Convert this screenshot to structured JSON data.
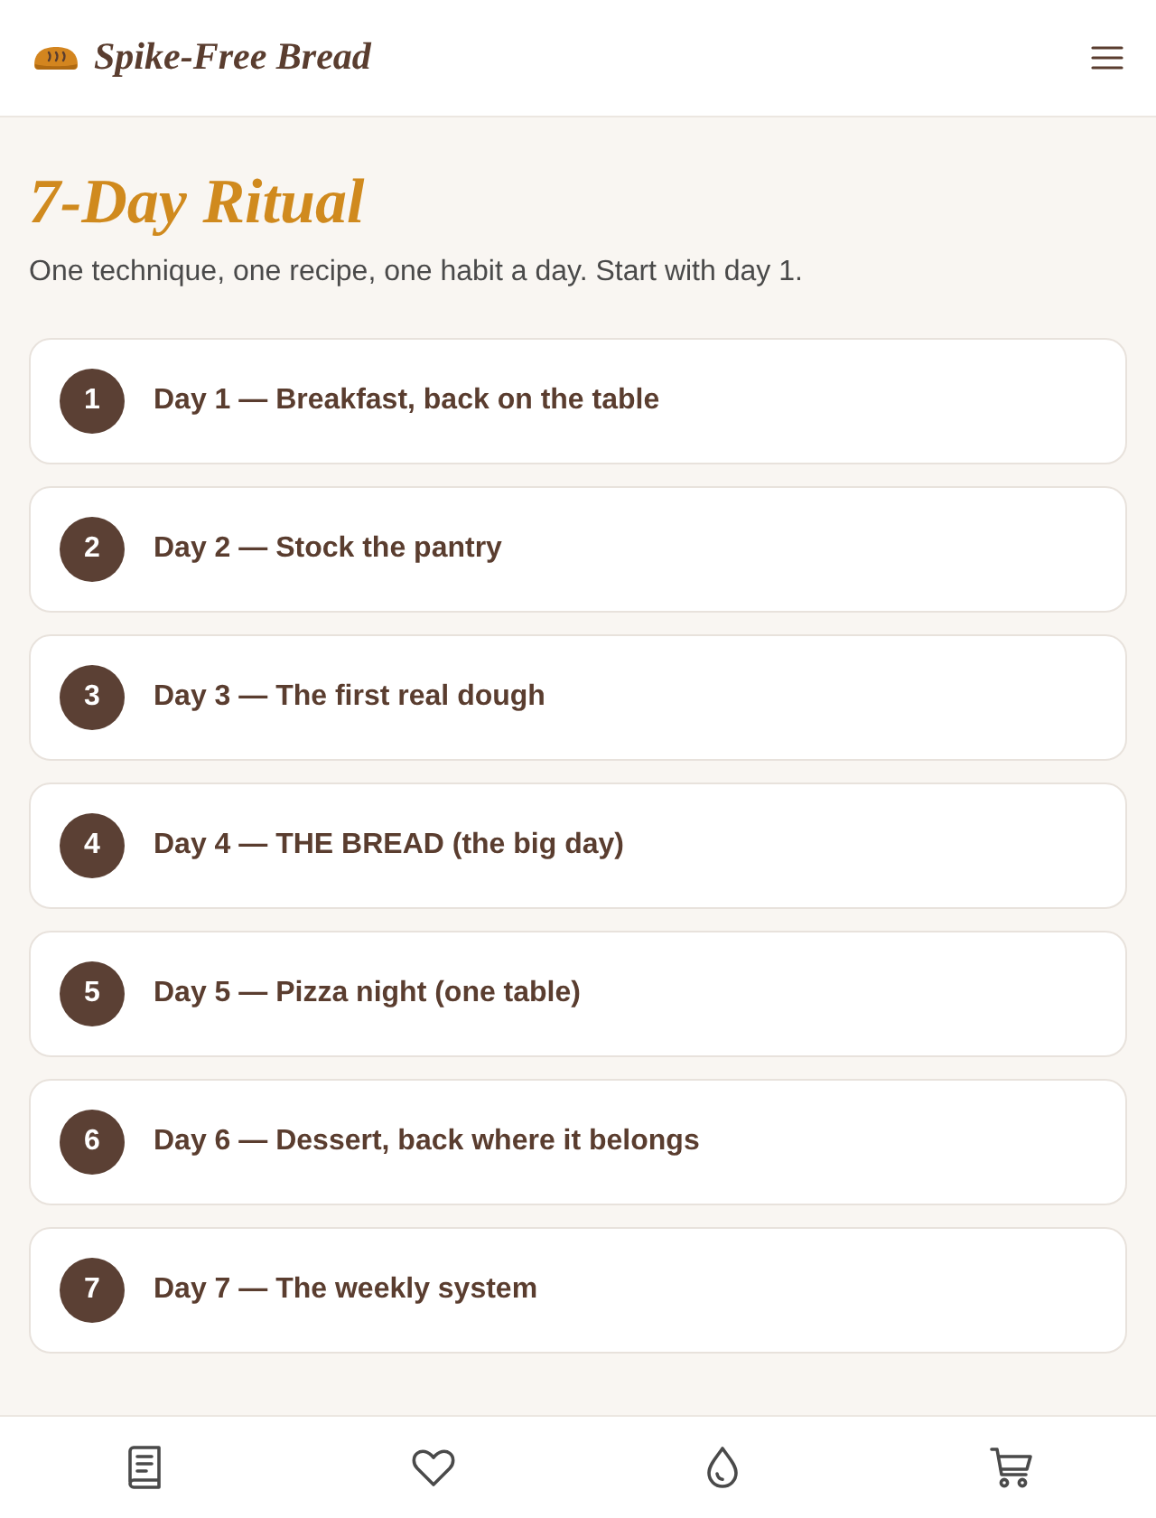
{
  "header": {
    "brand": "Spike-Free Bread"
  },
  "page": {
    "title": "7-Day Ritual",
    "subtitle": "One technique, one recipe, one habit a day. Start with day 1."
  },
  "days": [
    {
      "number": "1",
      "title": "Day 1 — Breakfast, back on the table"
    },
    {
      "number": "2",
      "title": "Day 2 — Stock the pantry"
    },
    {
      "number": "3",
      "title": "Day 3 — The first real dough"
    },
    {
      "number": "4",
      "title": "Day 4 — THE BREAD (the big day)"
    },
    {
      "number": "5",
      "title": "Day 5 — Pizza night (one table)"
    },
    {
      "number": "6",
      "title": "Day 6 — Dessert, back where it belongs"
    },
    {
      "number": "7",
      "title": "Day 7 — The weekly system"
    }
  ]
}
